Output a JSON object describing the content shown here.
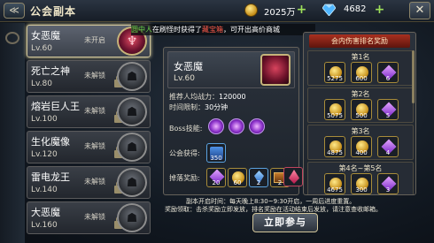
{
  "header": {
    "back_glyph": "≪",
    "title": "公会副本",
    "gold_value": "2025万",
    "gem_value": "4682",
    "plus": "+",
    "close_glyph": "✕"
  },
  "marquee": {
    "part1": "圆中人",
    "part2": "在刷怪时获得了",
    "part3": "藏宝箱",
    "part4": "，可开出高价商城"
  },
  "boss_list": [
    {
      "name": "女恶魔",
      "level": "Lv.60",
      "status": "未开启",
      "selected": true
    },
    {
      "name": "死亡之神",
      "level": "Lv.80",
      "status": "未解锁",
      "selected": false
    },
    {
      "name": "熔岩巨人王",
      "level": "Lv.100",
      "status": "未解锁",
      "selected": false
    },
    {
      "name": "生化魔像",
      "level": "Lv.120",
      "status": "未解锁",
      "selected": false
    },
    {
      "name": "雷电龙王",
      "level": "Lv.140",
      "status": "未解锁",
      "selected": false
    },
    {
      "name": "大恶魔",
      "level": "Lv.160",
      "status": "未解锁",
      "selected": false
    }
  ],
  "detail": {
    "name": "女恶魔",
    "level": "Lv.60",
    "power_label": "推荐人均战力：",
    "power_value": "120000",
    "time_label": "时间限制：",
    "time_value": "30分钟",
    "skill_label": "Boss技能:",
    "guild_label": "公会获得:",
    "guild_item_count": "350",
    "drop_label": "掉落奖励:",
    "drop_counts": [
      "20",
      "60",
      "2",
      "2",
      ""
    ]
  },
  "reward": {
    "title": "会内伤害排名奖励",
    "ranks": [
      {
        "label": "第1名",
        "counts": [
          "5275",
          "600",
          "6"
        ]
      },
      {
        "label": "第2名",
        "counts": [
          "5075",
          "500",
          "5"
        ]
      },
      {
        "label": "第3名",
        "counts": [
          "4875",
          "400",
          "4"
        ]
      },
      {
        "label": "第4名~第5名",
        "counts": [
          "4675",
          "300",
          "3"
        ]
      }
    ]
  },
  "notice": {
    "line1": "副本开启时间：每天晚上8:30~9:30开启，一周后进度重置。",
    "line2": "奖励领取：击杀奖励立即发放，排名奖励在活动结束后发放，请注意查收邮箱。"
  },
  "join_button": "立即参与"
}
